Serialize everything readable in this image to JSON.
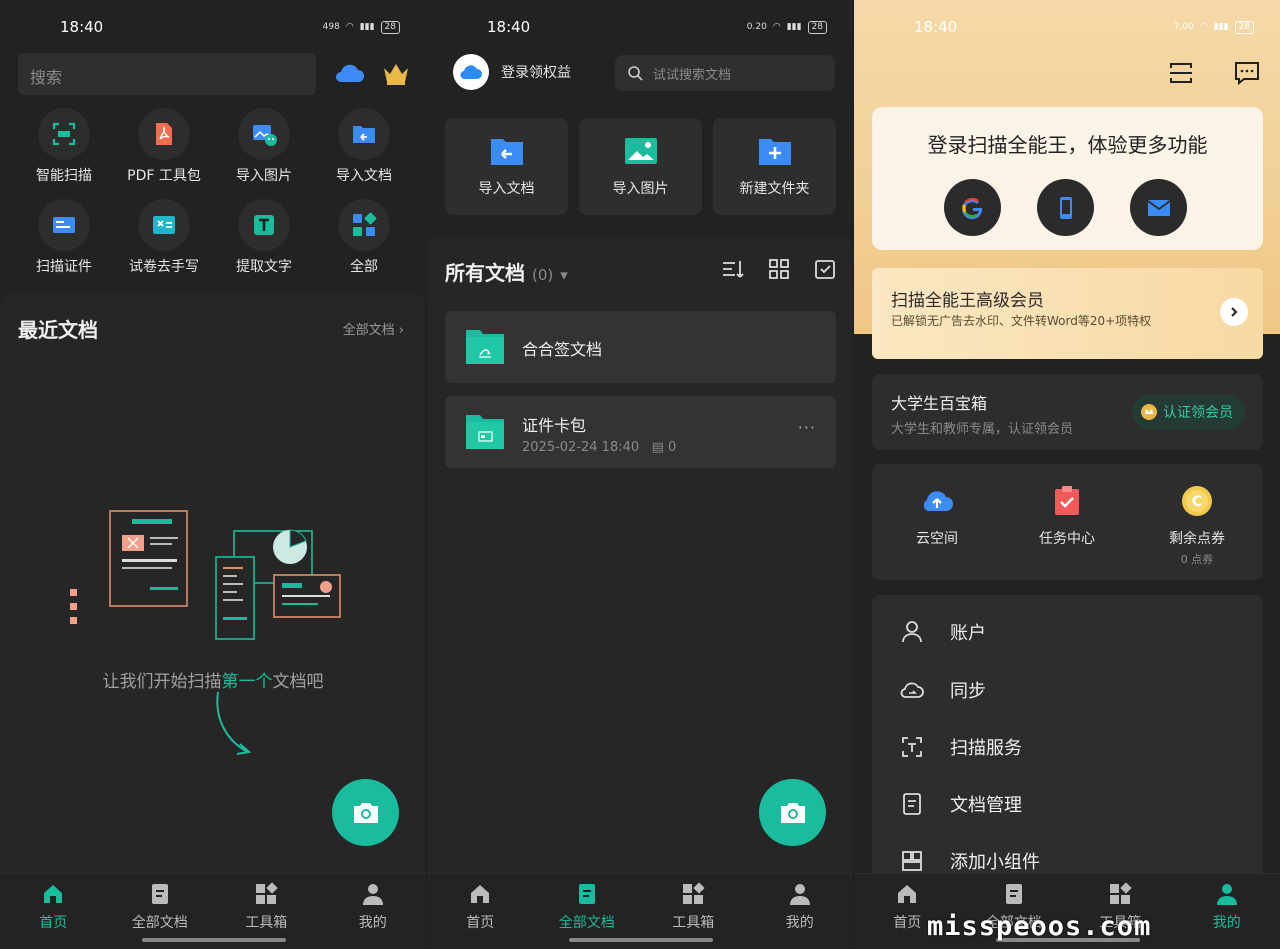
{
  "screen1": {
    "status": {
      "time": "18:40",
      "net": "498",
      "battery": "28"
    },
    "search_placeholder": "搜索",
    "tools": [
      "智能扫描",
      "PDF 工具包",
      "导入图片",
      "导入文档",
      "扫描证件",
      "试卷去手写",
      "提取文字",
      "全部"
    ],
    "recent_title": "最近文档",
    "recent_all": "全部文档 ›",
    "empty_text_a": "让我们开始扫描",
    "empty_text_hl": "第一个",
    "empty_text_b": "文档吧"
  },
  "screen2": {
    "status": {
      "time": "18:40",
      "net": "0.20",
      "battery": "28"
    },
    "login": "登录领权益",
    "search_placeholder": "试试搜索文档",
    "quick": [
      "导入文档",
      "导入图片",
      "新建文件夹"
    ],
    "all_docs_title": "所有文档",
    "all_docs_count": "(0)",
    "folders": [
      {
        "name": "合合签文档"
      },
      {
        "name": "证件卡包",
        "date": "2025-02-24 18:40",
        "count": "0"
      }
    ]
  },
  "screen3": {
    "status": {
      "time": "18:40",
      "net": "7.00",
      "battery": "28"
    },
    "login_title": "登录扫描全能王，体验更多功能",
    "vip_title": "扫描全能王高级会员",
    "vip_sub": "已解锁无广告去水印、文件转Word等20+项特权",
    "student_title": "大学生百宝箱",
    "student_sub": "大学生和教师专属，认证领会员",
    "student_btn": "认证领会员",
    "stats": [
      {
        "label": "云空间"
      },
      {
        "label": "任务中心"
      },
      {
        "label": "剩余点券",
        "sub": "0 点券"
      }
    ],
    "menu": [
      "账户",
      "同步",
      "扫描服务",
      "文档管理",
      "添加小组件"
    ]
  },
  "tabs": [
    "首页",
    "全部文档",
    "工具箱",
    "我的"
  ],
  "watermark": "misspeoos.com",
  "colors": {
    "accent": "#19bc9c",
    "gold": "#f2cf96"
  }
}
